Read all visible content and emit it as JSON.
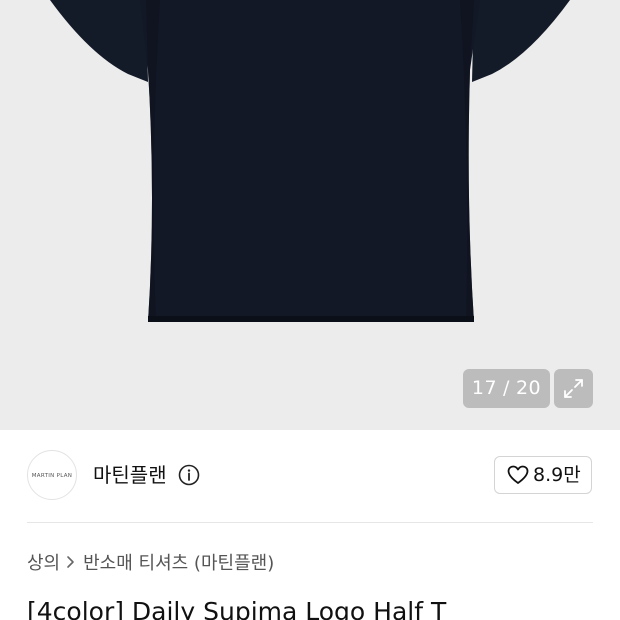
{
  "gallery": {
    "current_index": "17",
    "separator": "/",
    "total": "20",
    "expand_icon": "expand-icon",
    "colors": {
      "background": "#ececec",
      "shirt": "#121826"
    }
  },
  "brand": {
    "logo_text": "MARTIN PLAN",
    "name": "마틴플랜",
    "info_icon": "info-icon"
  },
  "like": {
    "icon": "heart-icon",
    "count": "8.9만"
  },
  "breadcrumb": {
    "items": [
      "상의",
      "반소매 티셔츠 (마틴플랜)"
    ],
    "separator_icon": "chevron-right-icon"
  },
  "product": {
    "title": "[4color] Daily Supima Logo Half T"
  }
}
